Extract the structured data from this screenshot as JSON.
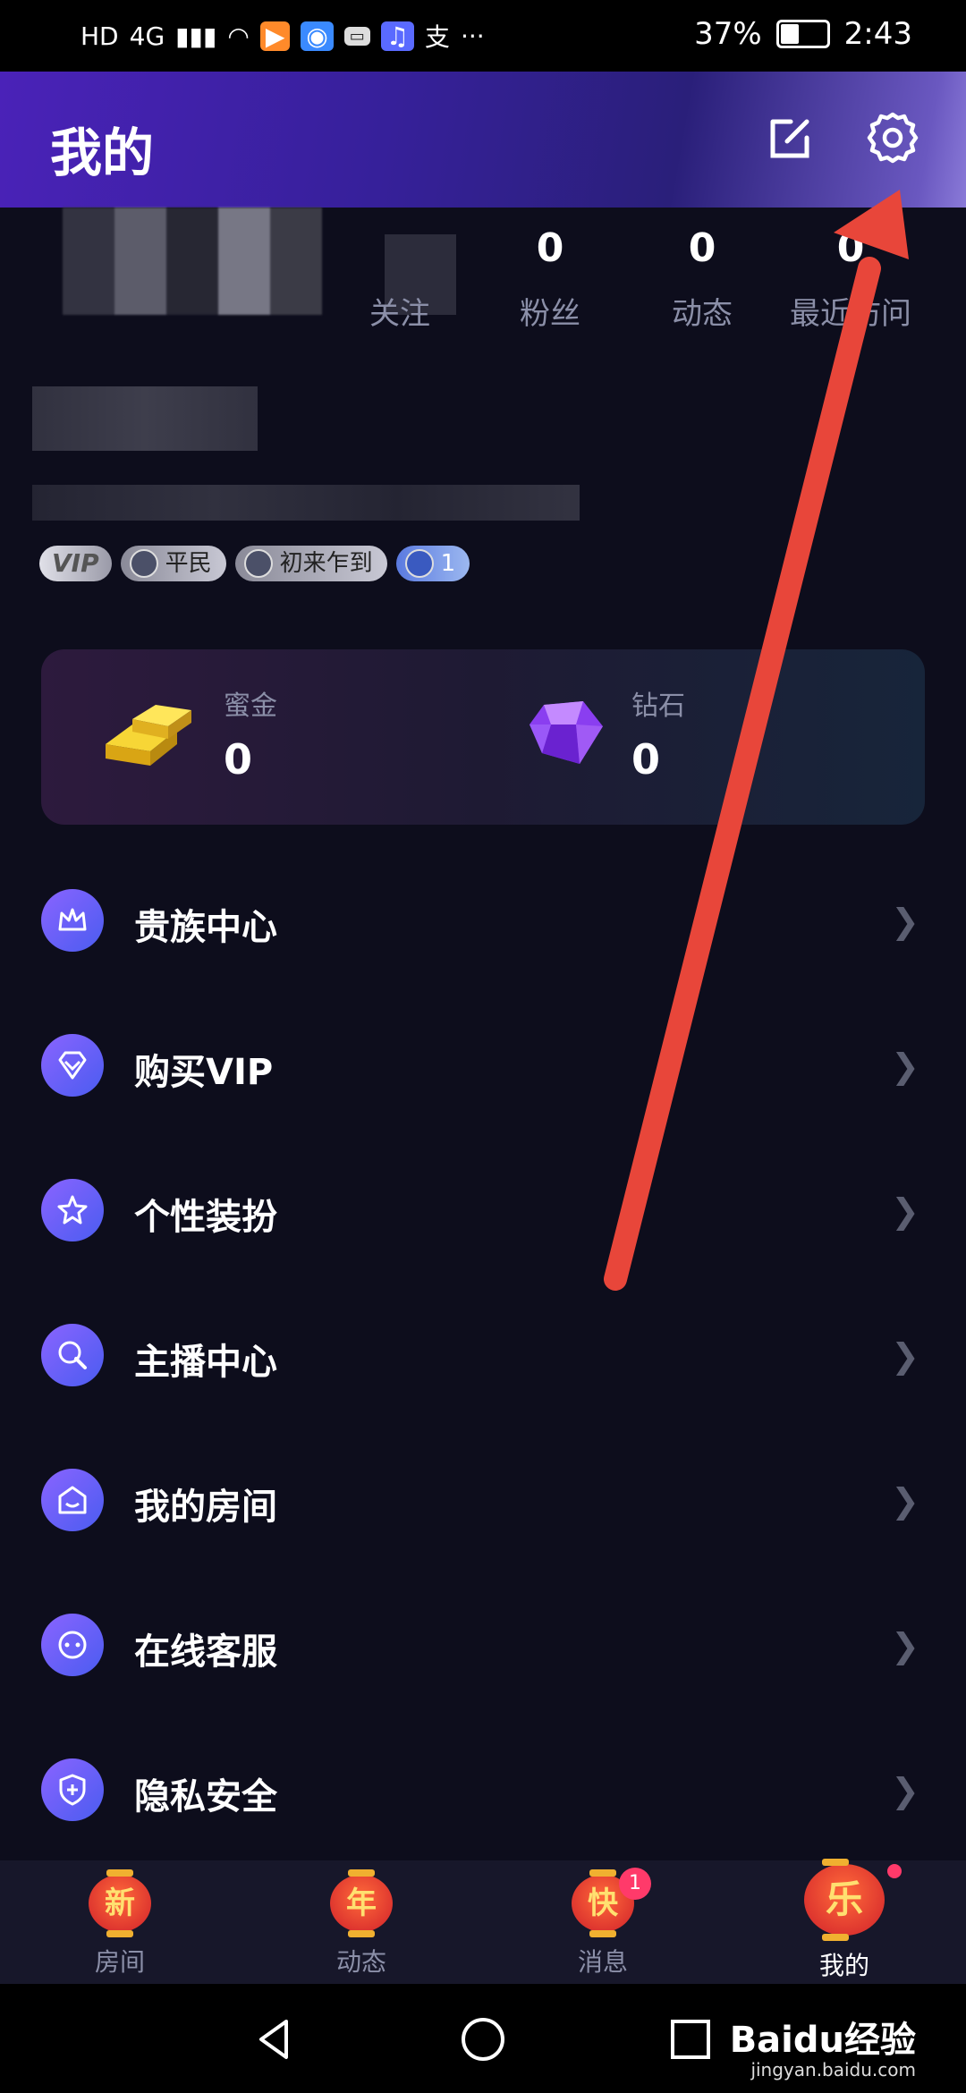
{
  "status_bar": {
    "left_icons": [
      "HD",
      "4G",
      "signal-icon",
      "wifi-icon",
      "app-icon",
      "app-icon",
      "app-icon",
      "app-icon",
      "支",
      "···"
    ],
    "battery": "37%",
    "battery_level": 0.37,
    "time": "2:43"
  },
  "header": {
    "title": "我的",
    "edit_icon": "edit-icon",
    "settings_icon": "gear-icon"
  },
  "profile": {
    "stats": [
      {
        "value": "0",
        "label": "粉丝"
      },
      {
        "value": "0",
        "label": "动态"
      },
      {
        "value": "0",
        "label": "最近访问"
      }
    ],
    "following_label": "关注",
    "badges": {
      "vip": "VIP",
      "rank": "平民",
      "title": "初来乍到",
      "level": "1"
    }
  },
  "wallet": {
    "honey": {
      "label": "蜜金",
      "value": "0"
    },
    "diamond": {
      "label": "钻石",
      "value": "0"
    }
  },
  "menu": [
    {
      "label": "贵族中心",
      "icon": "crown-icon"
    },
    {
      "label": "购买VIP",
      "icon": "diamond-vip-icon"
    },
    {
      "label": "个性装扮",
      "icon": "star-icon"
    },
    {
      "label": "主播中心",
      "icon": "microphone-icon"
    },
    {
      "label": "我的房间",
      "icon": "room-icon"
    },
    {
      "label": "在线客服",
      "icon": "chat-icon"
    },
    {
      "label": "隐私安全",
      "icon": "shield-icon"
    }
  ],
  "tabbar": [
    {
      "glyph": "新",
      "label": "房间"
    },
    {
      "glyph": "年",
      "label": "动态"
    },
    {
      "glyph": "快",
      "label": "消息",
      "badge": "1"
    },
    {
      "glyph": "乐",
      "label": "我的",
      "active": true
    }
  ],
  "watermark": {
    "brand": "Baidu经验",
    "url": "jingyan.baidu.com"
  },
  "colors": {
    "background": "#0d0d1c",
    "header_gradient_start": "#4a22b8",
    "accent_purple": "#8a64ff",
    "annotation_arrow": "#e8463a",
    "badge_red": "#ff3a6a"
  }
}
